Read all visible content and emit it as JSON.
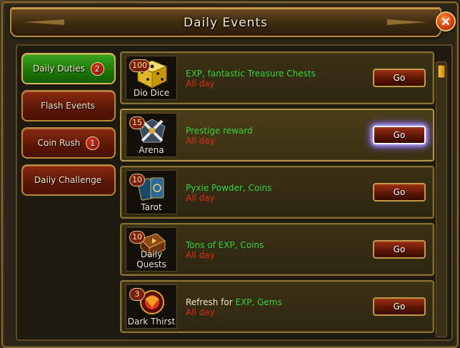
{
  "window": {
    "title": "Daily Events"
  },
  "sidebar": {
    "items": [
      {
        "label": "Daily Duties",
        "badge": "2",
        "active": true
      },
      {
        "label": "Flash Events",
        "badge": ""
      },
      {
        "label": "Coin Rush",
        "badge": "1"
      },
      {
        "label": "Daily Challenge",
        "badge": ""
      }
    ]
  },
  "events": [
    {
      "name": "Dio Dice",
      "count": "100",
      "reward_green": "EXP, fantastic Treasure Chests",
      "reward_white": "",
      "duration": "All day",
      "button": "Go",
      "icon": "dice-icon"
    },
    {
      "name": "Arena",
      "count": "15",
      "reward_green": "Prestige reward",
      "reward_white": "",
      "duration": "All day",
      "button": "Go",
      "icon": "crossed-swords-icon"
    },
    {
      "name": "Tarot",
      "count": "10",
      "reward_green": "Pyxie Powder, Coins",
      "reward_white": "",
      "duration": "All day",
      "button": "Go",
      "icon": "tarot-cards-icon"
    },
    {
      "name": "Daily Quests",
      "count": "10",
      "reward_green": "Tons of EXP, Coins",
      "reward_white": "",
      "duration": "All day",
      "button": "Go",
      "icon": "quest-book-icon"
    },
    {
      "name": "Dark Thirst",
      "count": "3",
      "reward_white": "Refresh for ",
      "reward_green": "EXP, Gems",
      "duration": "All day",
      "button": "Go",
      "icon": "dragon-orb-icon"
    }
  ],
  "colors": {
    "reward": "#38d23a",
    "duration": "#e02a18",
    "active_tab": "#1c7608",
    "inactive_tab": "#5a1606"
  }
}
